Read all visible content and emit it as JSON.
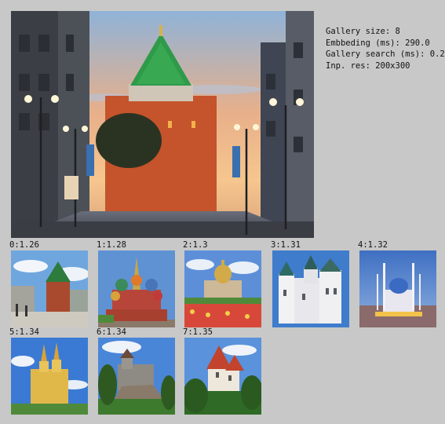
{
  "info": {
    "gallery_size": "Gallery size: 8",
    "embedding": "Embbeding (ms): 290.0",
    "gallery_search": "Gallery search (ms): 0.2",
    "inp_res": "Inp. res: 200x300"
  },
  "results": [
    {
      "label": "0:1.26",
      "icon": "kremlin-tower-thumbnail"
    },
    {
      "label": "1:1.28",
      "icon": "saint-basils-cathedral-thumbnail"
    },
    {
      "label": "2:1.3",
      "icon": "isaac-cathedral-thumbnail"
    },
    {
      "label": "3:1.31",
      "icon": "white-castle-thumbnail"
    },
    {
      "label": "4:1.32",
      "icon": "mosque-thumbnail"
    },
    {
      "label": "5:1.34",
      "icon": "yellow-cathedral-thumbnail"
    },
    {
      "label": "6:1.34",
      "icon": "hill-castle-thumbnail"
    },
    {
      "label": "7:1.35",
      "icon": "red-roof-castle-thumbnail"
    }
  ]
}
